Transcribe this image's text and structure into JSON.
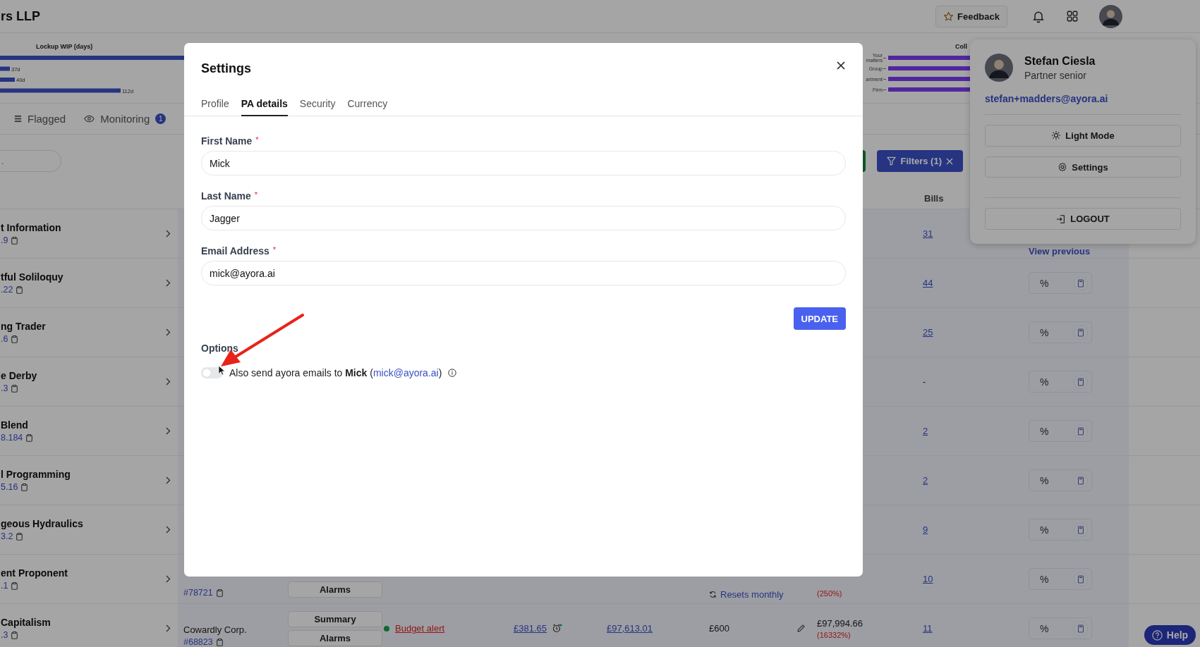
{
  "header": {
    "title": "rs LLP",
    "feedback_button": "Feedback"
  },
  "lockup_chart": {
    "title": "Lockup WIP (days)",
    "bar_labels": [
      "37d",
      "40d",
      "112d"
    ]
  },
  "collection_chart": {
    "title": "Coll",
    "labels": [
      {
        "lines": [
          "Your",
          "matters"
        ]
      },
      {
        "lines": [
          "Group"
        ]
      },
      {
        "lines": [
          "artment"
        ]
      },
      {
        "lines": [
          "Firm"
        ]
      }
    ]
  },
  "view_tabs": [
    {
      "label": "Flagged"
    },
    {
      "label": "Monitoring",
      "badge": "1"
    }
  ],
  "search_field": {
    "placeholder": "."
  },
  "filters_button": "Filters (1)",
  "table": {
    "columns": [
      "Bills"
    ],
    "rows": [
      {
        "name": "t Information",
        "code": ".9",
        "bills": "31",
        "bills_link": true,
        "pct_cell": {
          "kind": "link",
          "text": "View previous"
        }
      },
      {
        "name": "tful Soliloquy",
        "code": ".22",
        "bills": "44",
        "bills_link": true,
        "pct_cell": {
          "kind": "field",
          "placeholder": "%"
        }
      },
      {
        "name": "ng Trader",
        "code": ".6",
        "bills": "25",
        "bills_link": true,
        "pct_cell": {
          "kind": "field",
          "placeholder": "%"
        }
      },
      {
        "name": "e Derby",
        "code": ".3",
        "bills": "-",
        "bills_link": false,
        "pct_cell": {
          "kind": "field",
          "placeholder": "%"
        }
      },
      {
        "name": "Blend",
        "code": "8.184",
        "bills": "2",
        "bills_link": true,
        "pct_cell": {
          "kind": "field",
          "placeholder": "%"
        }
      },
      {
        "name": "l Programming",
        "code": "5.16",
        "bills": "2",
        "bills_link": true,
        "pct_cell": {
          "kind": "field",
          "placeholder": "%"
        }
      },
      {
        "name": "geous Hydraulics",
        "code": "3.2",
        "bills": "9",
        "bills_link": true,
        "pct_cell": {
          "kind": "field",
          "placeholder": "%"
        }
      },
      {
        "name": "ent Proponent",
        "code": ".1",
        "bills": "10",
        "bills_link": true,
        "pct_cell": {
          "kind": "field",
          "placeholder": "%"
        },
        "client_code": "#78721",
        "actions": [
          "Alarms"
        ],
        "budget_note": "Resets monthly",
        "total_pct": "(250%)"
      },
      {
        "name": "Capitalism",
        "code": ".3",
        "bills": "11",
        "bills_link": true,
        "pct_cell": {
          "kind": "field",
          "placeholder": "%"
        },
        "client": "Cowardly Corp.",
        "client_code": "#68823",
        "actions": [
          "Summary",
          "Alarms"
        ],
        "alert": "Budget alert",
        "wip": "£381.65",
        "billed": "£97,613.01",
        "budget": "£600",
        "total": "£97,994.66",
        "total_pct": "(16332%)"
      }
    ]
  },
  "user_menu": {
    "name": "Stefan Ciesla",
    "role": "Partner senior",
    "email": "stefan+madders@ayora.ai",
    "buttons": [
      {
        "label": "Light Mode"
      },
      {
        "label": "Settings"
      },
      {
        "label": "LOGOUT"
      }
    ]
  },
  "help_button": "Help",
  "settings_dialog": {
    "title": "Settings",
    "tabs": [
      {
        "label": "Profile",
        "selected": false
      },
      {
        "label": "PA details",
        "selected": true
      },
      {
        "label": "Security",
        "selected": false
      },
      {
        "label": "Currency",
        "selected": false
      }
    ],
    "fields": [
      {
        "label": "First Name",
        "required_mark": "*",
        "value": "Mick"
      },
      {
        "label": "Last Name",
        "required_mark": "*",
        "value": "Jagger"
      },
      {
        "label": "Email Address",
        "required_mark": "*",
        "value": "mick@ayora.ai"
      }
    ],
    "update_button": "UPDATE",
    "options_heading": "Options",
    "options": [
      {
        "kind": "toggle",
        "on": false,
        "text_before": "Also send ayora emails to **Mick** (",
        "link": "mick@ayora.ai",
        "text_after": ")"
      }
    ]
  }
}
